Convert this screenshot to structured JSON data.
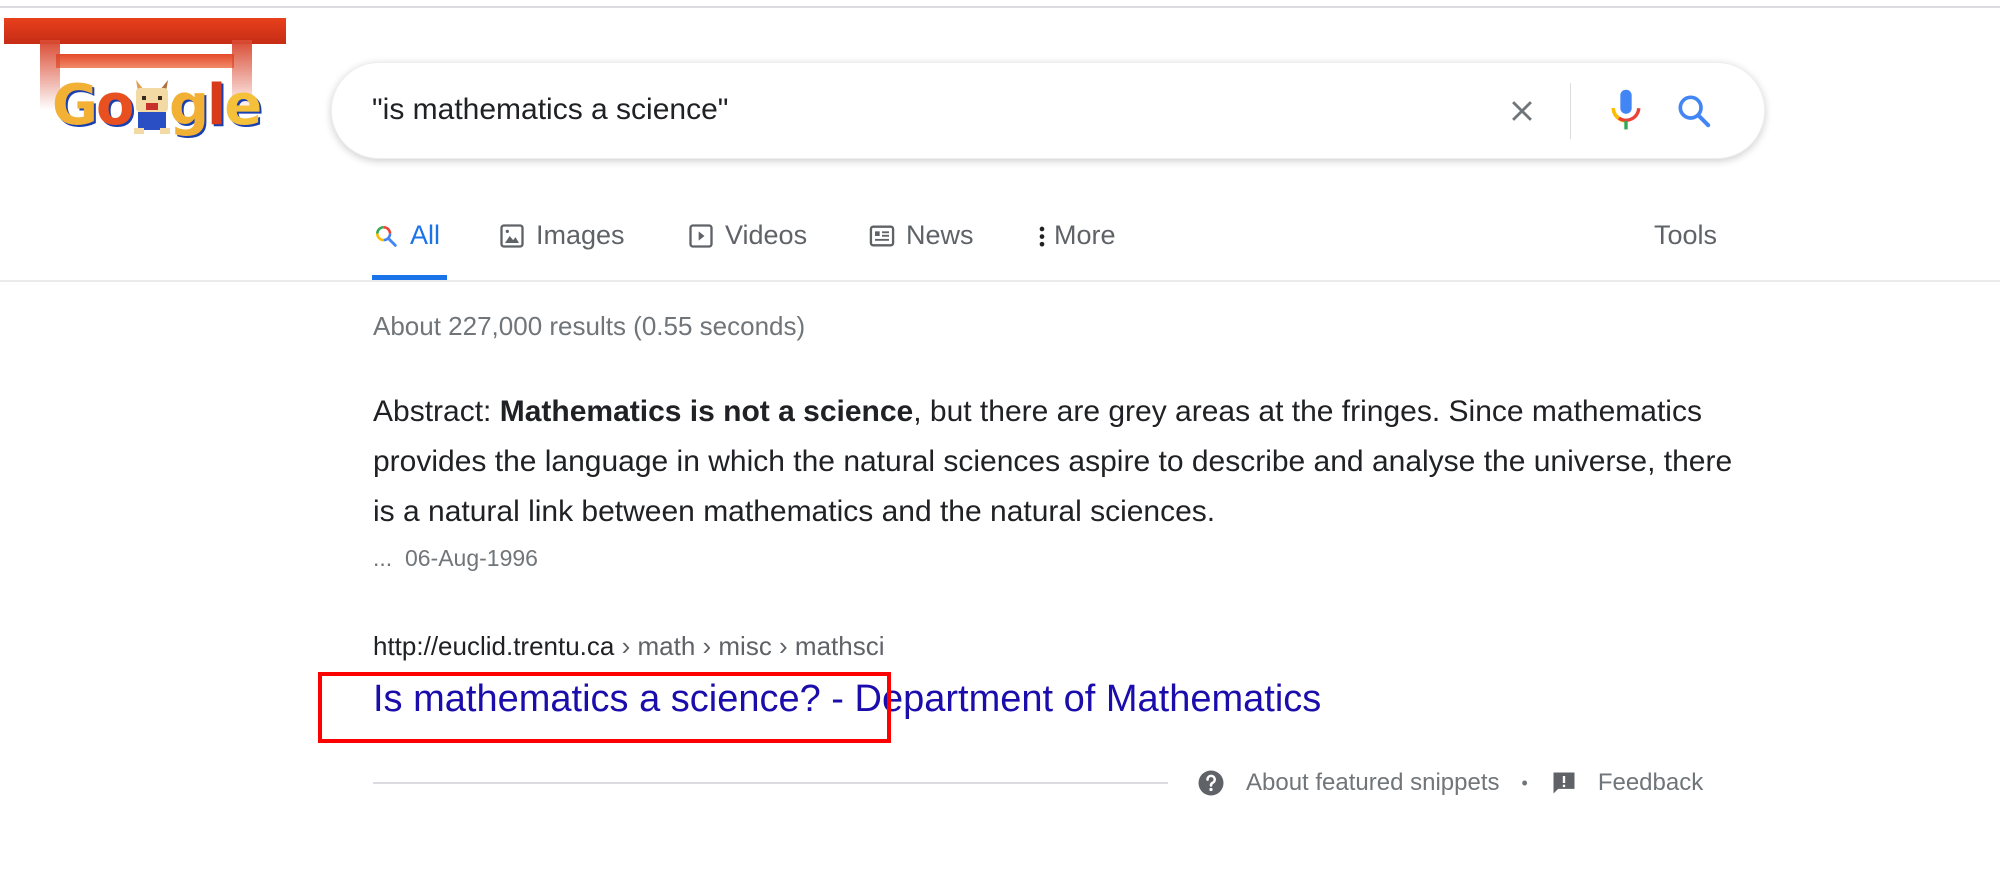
{
  "logo": {
    "text_letters": [
      "G",
      "o",
      "o",
      "g",
      "l",
      "e"
    ],
    "alt": "Google doodle"
  },
  "search": {
    "query": "\"is mathematics a science\"",
    "clear_icon": "close-icon",
    "mic_icon": "microphone-icon",
    "search_icon": "search-icon"
  },
  "tabs": [
    {
      "label": "All",
      "icon": "search-icon",
      "active": true
    },
    {
      "label": "Images",
      "icon": "image-icon",
      "active": false
    },
    {
      "label": "Videos",
      "icon": "play-icon",
      "active": false
    },
    {
      "label": "News",
      "icon": "newspaper-icon",
      "active": false
    },
    {
      "label": "More",
      "icon": "more-vert-icon",
      "active": false
    }
  ],
  "tools_label": "Tools",
  "result_stats": "About 227,000 results (0.55 seconds)",
  "featured_snippet": {
    "prefix": "Abstract: ",
    "bold": "Mathematics is not a science",
    "rest": ", but there are grey areas at the fringes. Since mathematics provides the language in which the natural sciences aspire to describe and analyse the universe, there is a natural link between mathematics and the natural sciences.",
    "ellipsis": "...",
    "date": "06-Aug-1996"
  },
  "result": {
    "domain": "http://euclid.trentu.ca",
    "breadcrumbs": " › math › misc › mathsci",
    "title": "Is mathematics a science? - Department of Mathematics"
  },
  "footer": {
    "about_label": "About featured snippets",
    "separator": "•",
    "feedback_label": "Feedback"
  },
  "colors": {
    "link": "#1a0dab",
    "accent": "#1a73e8",
    "highlight_box": "#ff0000",
    "muted_text": "#70757a"
  }
}
